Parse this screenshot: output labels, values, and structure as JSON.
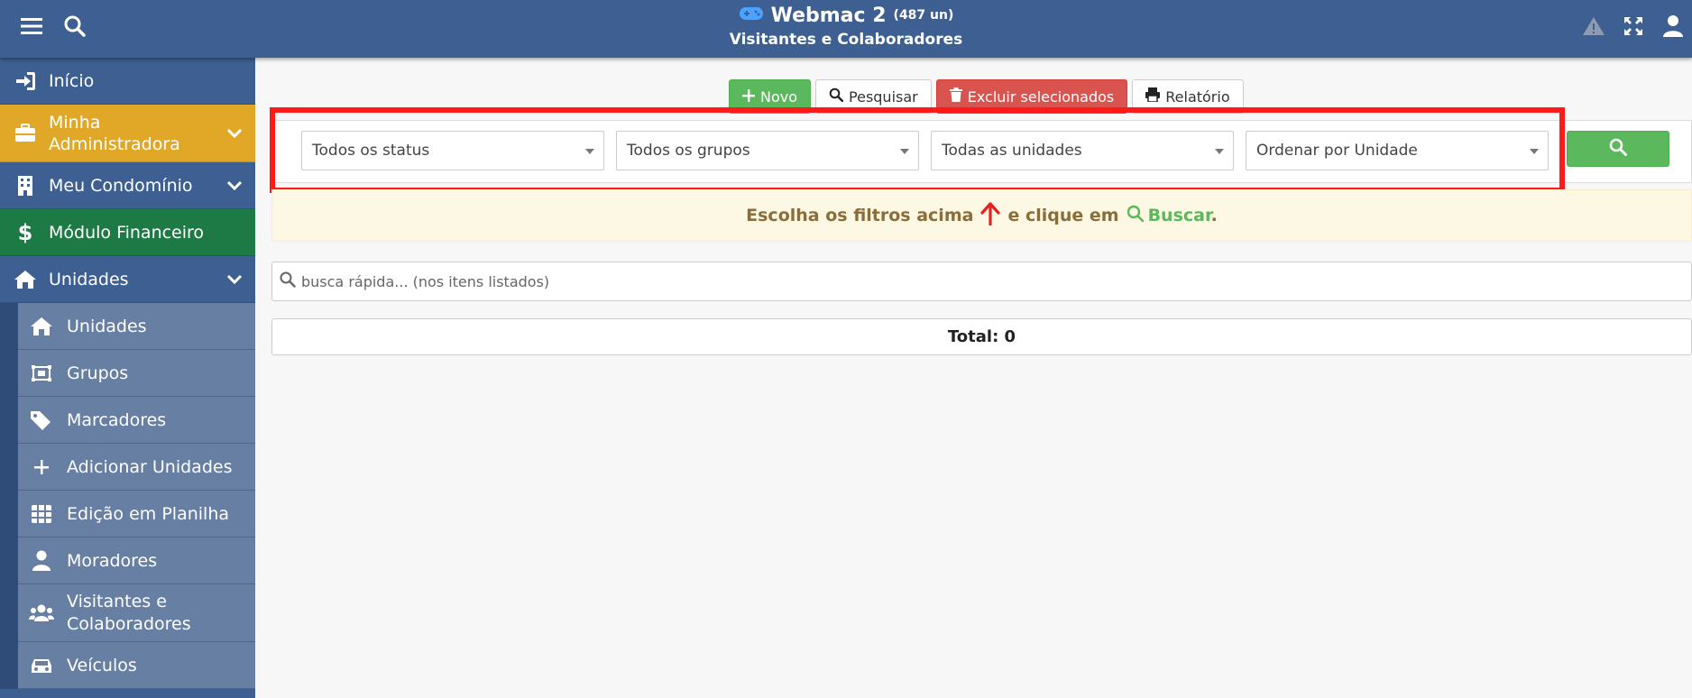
{
  "header": {
    "app_name": "Webmac 2",
    "app_count": "(487 un)",
    "page_title": "Visitantes e Colaboradores",
    "icons": [
      "menu-icon",
      "search-icon",
      "gamepad-icon",
      "warning-icon",
      "expand-icon",
      "user-icon"
    ]
  },
  "sidebar": {
    "items": [
      {
        "label": "Início",
        "icon": "sign-in-icon"
      },
      {
        "label": "Minha Administradora",
        "icon": "briefcase-icon"
      },
      {
        "label": "Meu Condomínio",
        "icon": "building-icon"
      },
      {
        "label": "Módulo Financeiro",
        "icon": "dollar-icon"
      },
      {
        "label": "Unidades",
        "icon": "home-icon"
      }
    ],
    "subitems": [
      {
        "label": "Unidades",
        "icon": "home-icon"
      },
      {
        "label": "Grupos",
        "icon": "object-group-icon"
      },
      {
        "label": "Marcadores",
        "icon": "tags-icon"
      },
      {
        "label": "Adicionar Unidades",
        "icon": "plus-icon"
      },
      {
        "label": "Edição em Planilha",
        "icon": "table-icon"
      },
      {
        "label": "Moradores",
        "icon": "user-icon"
      },
      {
        "label": "Visitantes e Colaboradores",
        "icon": "users-icon"
      },
      {
        "label": "Veículos",
        "icon": "car-icon"
      }
    ]
  },
  "toolbar": {
    "new_label": "Novo",
    "search_label": "Pesquisar",
    "delete_label": "Excluir selecionados",
    "report_label": "Relatório"
  },
  "filters": {
    "status": "Todos os status",
    "groups": "Todos os grupos",
    "units": "Todas as unidades",
    "order": "Ordenar por Unidade"
  },
  "hint": {
    "text_before": "Escolha os filtros acima",
    "text_middle": "e clique em",
    "buscar": "Buscar",
    "period": "."
  },
  "quick_search": {
    "placeholder": "busca rápida... (nos itens listados)"
  },
  "total": {
    "label": "Total: 0"
  },
  "colors": {
    "header": "#3d5f91",
    "admin": "#e0a826",
    "finance": "#1e7a45",
    "submenu": "#667fa3",
    "success": "#5cb85c",
    "danger": "#d9534f",
    "highlight": "#ff1a1a"
  }
}
